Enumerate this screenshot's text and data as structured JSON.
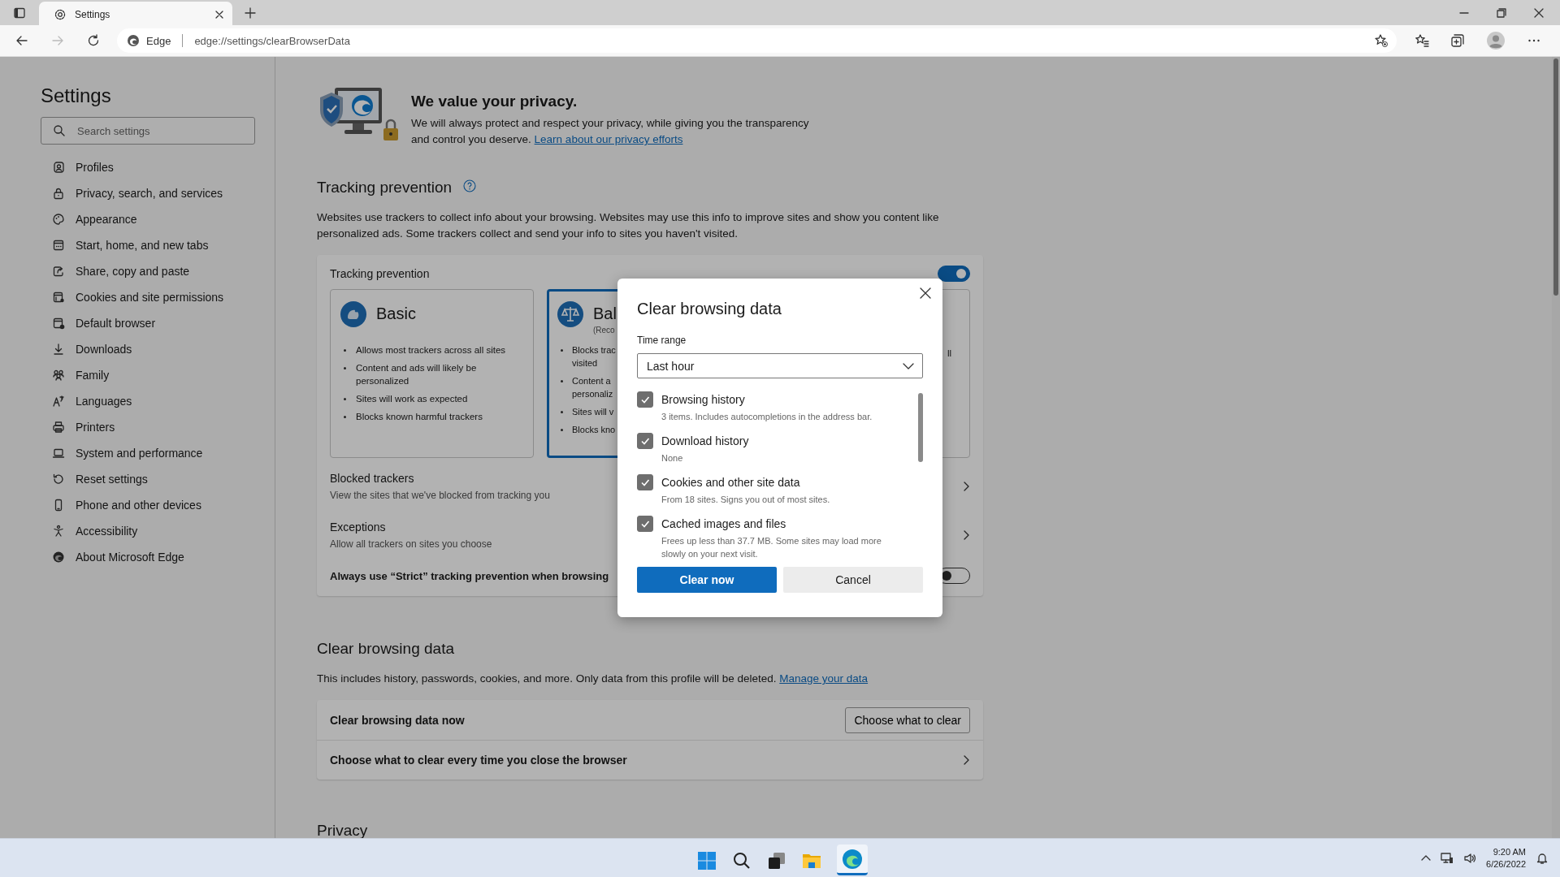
{
  "browser": {
    "tab": {
      "title": "Settings"
    },
    "address": {
      "site_label": "Edge",
      "url": "edge://settings/clearBrowserData"
    }
  },
  "sidebar": {
    "title": "Settings",
    "search": {
      "placeholder": "Search settings"
    },
    "items": [
      {
        "label": "Profiles"
      },
      {
        "label": "Privacy, search, and services"
      },
      {
        "label": "Appearance"
      },
      {
        "label": "Start, home, and new tabs"
      },
      {
        "label": "Share, copy and paste"
      },
      {
        "label": "Cookies and site permissions"
      },
      {
        "label": "Default browser"
      },
      {
        "label": "Downloads"
      },
      {
        "label": "Family"
      },
      {
        "label": "Languages"
      },
      {
        "label": "Printers"
      },
      {
        "label": "System and performance"
      },
      {
        "label": "Reset settings"
      },
      {
        "label": "Phone and other devices"
      },
      {
        "label": "Accessibility"
      },
      {
        "label": "About Microsoft Edge"
      }
    ]
  },
  "privacy_banner": {
    "title": "We value your privacy.",
    "text": "We will always protect and respect your privacy, while giving you the transparency and control you deserve.",
    "link": "Learn about our privacy efforts"
  },
  "tracking": {
    "heading": "Tracking prevention",
    "description": "Websites use trackers to collect info about your browsing. Websites may use this info to improve sites and show you content like personalized ads. Some trackers collect and send your info to sites you haven't visited.",
    "card_title": "Tracking prevention",
    "on": true,
    "levels": [
      {
        "title": "Basic",
        "selected": false,
        "bullets": [
          {
            "lines": [
              "Allows most trackers across all sites"
            ]
          },
          {
            "lines": [
              "Content and ads will likely be",
              "personalized"
            ]
          },
          {
            "lines": [
              "Sites will work as expected"
            ]
          },
          {
            "lines": [
              "Blocks known harmful trackers"
            ]
          }
        ]
      },
      {
        "title": "Bal",
        "subtitle": "(Reco",
        "selected": true,
        "bullets": [
          {
            "lines": [
              "Blocks trac",
              "visited"
            ]
          },
          {
            "lines": [
              "Content a",
              "personaliz"
            ]
          },
          {
            "lines": [
              "Sites will v"
            ]
          },
          {
            "lines": [
              "Blocks kno"
            ]
          }
        ]
      },
      {
        "selected": false,
        "bullets": [
          {
            "lines": [
              "ll"
            ]
          }
        ]
      }
    ],
    "rows": [
      {
        "title": "Blocked trackers",
        "subtitle": "View the sites that we've blocked from tracking you"
      },
      {
        "title": "Exceptions",
        "subtitle": "Allow all trackers on sites you choose"
      }
    ],
    "strict_inprivate": {
      "label": "Always use “Strict” tracking prevention when browsing",
      "on": false
    }
  },
  "clear_section": {
    "heading": "Clear browsing data",
    "text": "This includes history, passwords, cookies, and more. Only data from this profile will be deleted.",
    "link": "Manage your data",
    "rows": [
      {
        "kind": "button",
        "label": "Clear browsing data now",
        "button": "Choose what to clear"
      },
      {
        "kind": "link",
        "label": "Choose what to clear every time you close the browser"
      }
    ]
  },
  "next_heading": "Privacy",
  "dialog": {
    "title": "Clear browsing data",
    "time_range": {
      "label": "Time range",
      "value": "Last hour"
    },
    "items": [
      {
        "label": "Browsing history",
        "detail": "3 items. Includes autocompletions in the address bar.",
        "checked": true
      },
      {
        "label": "Download history",
        "detail": "None",
        "checked": true
      },
      {
        "label": "Cookies and other site data",
        "detail": "From 18 sites. Signs you out of most sites.",
        "checked": true
      },
      {
        "label": "Cached images and files",
        "detail": "Frees up less than 37.7 MB. Some sites may load more slowly on your next visit.",
        "checked": true
      }
    ],
    "buttons": [
      {
        "kind": "primary",
        "label": "Clear now"
      },
      {
        "kind": "secondary",
        "label": "Cancel"
      }
    ]
  },
  "taskbar": {
    "time": "9:20 AM",
    "date": "6/26/2022"
  }
}
